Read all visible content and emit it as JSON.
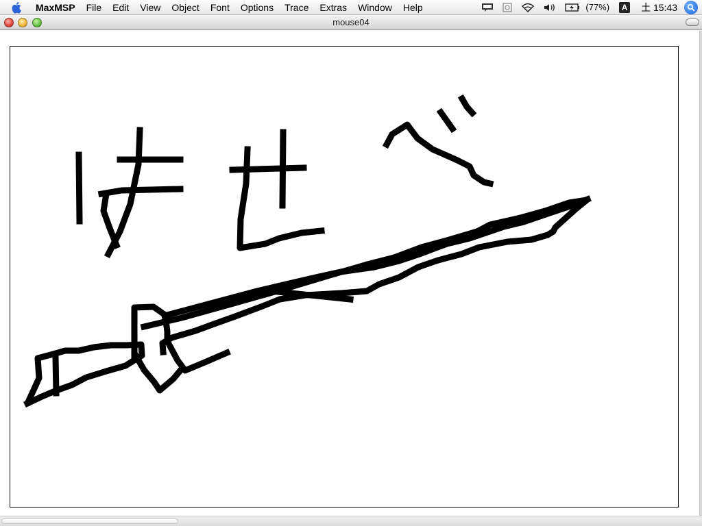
{
  "menubar": {
    "apple_icon": "apple-logo",
    "app_name": "MaxMSP",
    "items": [
      "File",
      "Edit",
      "View",
      "Object",
      "Font",
      "Options",
      "Trace",
      "Extras",
      "Window",
      "Help"
    ],
    "status": {
      "battery_text": "(77%)",
      "input_menu": "A",
      "clock": "土 15:43"
    }
  },
  "window": {
    "title": "mouse04"
  },
  "colors": {
    "ink": "#000000",
    "canvas": "#ffffff",
    "spotlight": "#1f63d8"
  }
}
